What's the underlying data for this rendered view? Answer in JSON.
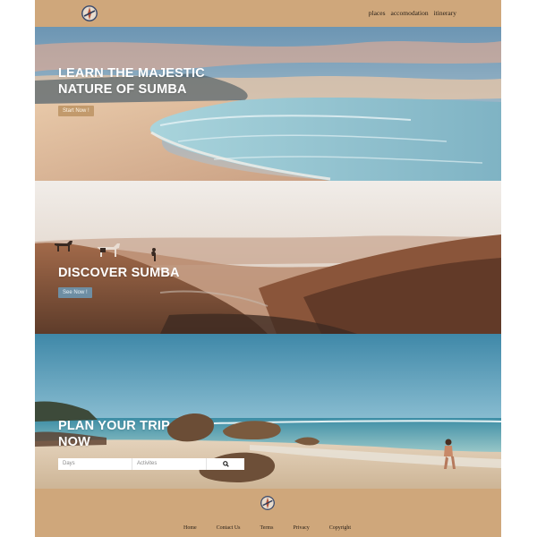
{
  "header": {
    "logo_icon": "compass-logo-icon",
    "nav": [
      "places",
      "accomodation",
      "itinerary"
    ]
  },
  "hero1": {
    "title": "LEARN THE MAJESTIC\nNATURE OF SUMBA",
    "cta": "Start Now !"
  },
  "hero2": {
    "title": "DISCOVER SUMBA",
    "cta": "See Now !"
  },
  "hero3": {
    "title": "PLAN YOUR TRIP\nNOW",
    "search": {
      "days_placeholder": "Days",
      "activities_placeholder": "Activites",
      "search_icon": "search-icon"
    }
  },
  "footer": {
    "links": [
      "Home",
      "Contact Us",
      "Terms",
      "Privacy",
      "Copyright"
    ]
  },
  "colors": {
    "brand_tan": "#cfa77b",
    "cta_tan": "#c29a6c",
    "cta_blue": "#6e8ea3"
  }
}
